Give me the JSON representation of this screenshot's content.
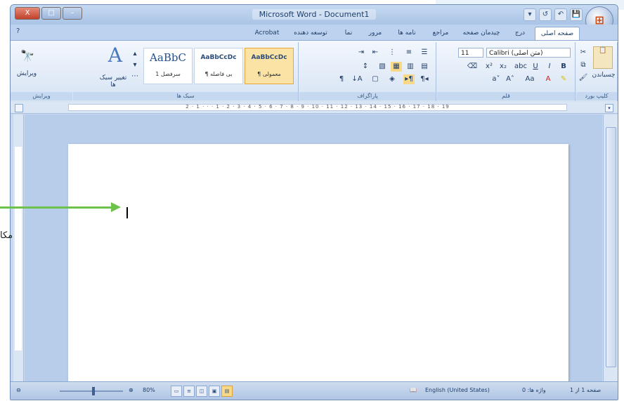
{
  "window": {
    "title": "Microsoft Word - Document1",
    "caption_buttons": {
      "close": "X",
      "maximize": "□",
      "minimize": "–"
    },
    "qat": [
      "▾",
      "↺",
      "↶",
      "💾"
    ],
    "office_button": "⊞"
  },
  "tabs": [
    {
      "label": "صفحه اصلی",
      "active": true
    },
    {
      "label": "درج",
      "active": false
    },
    {
      "label": "چیدمان صفحه",
      "active": false
    },
    {
      "label": "مراجع",
      "active": false
    },
    {
      "label": "نامه ها",
      "active": false
    },
    {
      "label": "مرور",
      "active": false
    },
    {
      "label": "نما",
      "active": false
    },
    {
      "label": "توسعه دهنده",
      "active": false
    },
    {
      "label": "Acrobat",
      "active": false
    }
  ],
  "ribbon": {
    "clipboard": {
      "label": "کلیپ بورد",
      "paste": "چسباندن"
    },
    "font": {
      "label": "قلم",
      "font_name": "Calibri (متن اصلی)",
      "font_size": "11",
      "bold": "B",
      "italic": "I",
      "underline": "U"
    },
    "paragraph": {
      "label": "پاراگراف"
    },
    "styles": {
      "label": "سبک ها",
      "items": [
        {
          "sample": "AaBbCcDc",
          "name": "¶ معمولی",
          "selected": true
        },
        {
          "sample": "AaBbCcDc",
          "name": "¶ بی فاصله",
          "selected": false
        },
        {
          "sample": "AaBbC",
          "name": "سرفصل 1",
          "selected": false
        }
      ],
      "change_styles": "تغییر سبک ها"
    },
    "editing": {
      "label": "ویرایش",
      "find": "ویرایش"
    }
  },
  "ruler": {
    "marks": "2 · 1 · · · 1 · 2 · 3 · 4 · 5 · 6 · 7 · 8 · 9 · 10 · 11 · 12 · 13 · 14 · 15 · 16 · 17 · 18 · 19"
  },
  "status": {
    "page": "صفحه 1 از 1",
    "words": "واژه ها: 0",
    "language": "English (United States)",
    "zoom": "80%"
  },
  "annotation": {
    "callout": "مکا"
  },
  "colors": {
    "accent": "#6cc24a",
    "ribbon": "#d6e3f4",
    "selected_style": "#fbe3a6"
  }
}
